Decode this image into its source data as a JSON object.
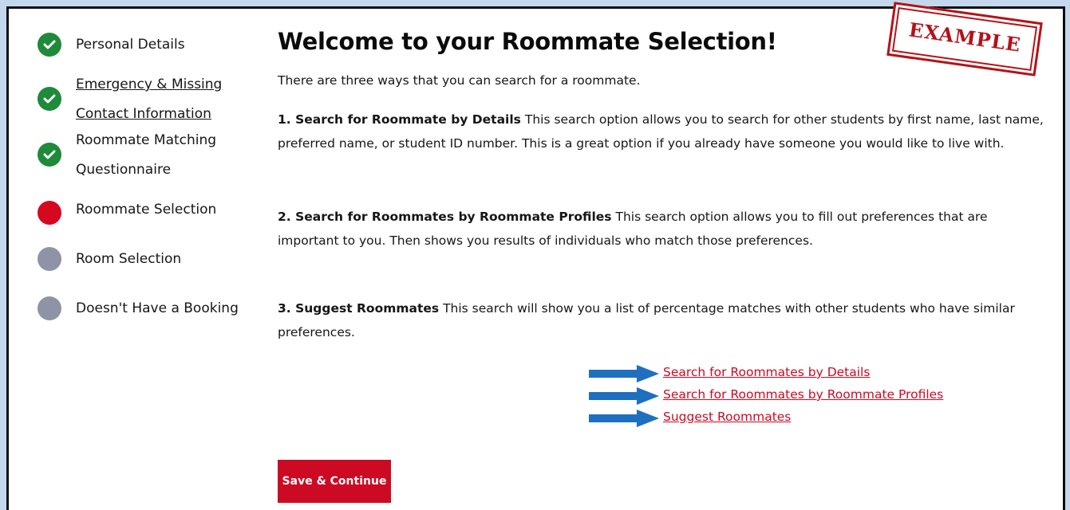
{
  "stamp": {
    "text": "EXAMPLE"
  },
  "sidebar": {
    "steps": [
      {
        "label_lines": [
          "Personal Details"
        ],
        "status": "done",
        "link": false
      },
      {
        "label_lines": [
          "Emergency & Missing",
          "Contact Information"
        ],
        "status": "done",
        "link": true
      },
      {
        "label_lines": [
          "Roommate Matching",
          "Questionnaire"
        ],
        "status": "done",
        "link": false
      },
      {
        "label_lines": [
          "Roommate Selection"
        ],
        "status": "current",
        "link": false
      },
      {
        "label_lines": [
          "Room Selection"
        ],
        "status": "pending",
        "link": false
      },
      {
        "label_lines": [
          "Doesn't Have a Booking"
        ],
        "status": "pending",
        "link": false
      }
    ],
    "status_colors": {
      "done": "#1e8a3a",
      "current": "#d5081f",
      "pending": "#8e93a6"
    }
  },
  "main": {
    "title": "Welcome to your Roommate Selection!",
    "intro": "There are three ways that you can search for a roommate.",
    "options": [
      {
        "heading": "1. Search for Roommate by Details",
        "description": " This search option allows you to search for other students by first name, last name, preferred name, or student ID number. This is a great option if you already have someone you would like to live with."
      },
      {
        "heading": "2. Search for Roommates by Roommate Profiles",
        "description": " This search option allows you to fill out preferences that are important to you. Then shows you results of individuals who match those preferences."
      },
      {
        "heading": "3. Suggest Roommates",
        "description": " This search will show you a list of percentage matches with other students who have similar preferences."
      }
    ],
    "links": [
      "Search for Roommates by Details",
      "Search for Roommates by Roommate Profiles",
      "Suggest Roommates"
    ],
    "save_button": "Save & Continue"
  },
  "colors": {
    "accent": "#cc0a23",
    "arrow": "#1f6fc0",
    "background": "#c5d7ec"
  }
}
